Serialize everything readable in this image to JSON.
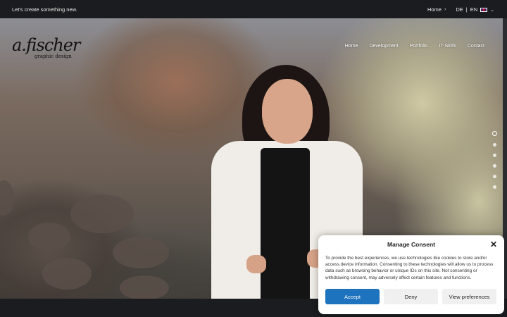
{
  "topbar": {
    "tagline": "Let's create something new.",
    "home_label": "Home",
    "lang_de": "DE",
    "lang_separator": "|",
    "lang_en": "EN"
  },
  "logo": {
    "signature": "a.fischer",
    "subtitle": "graphic design"
  },
  "nav": {
    "items": [
      {
        "label": "Home"
      },
      {
        "label": "Development"
      },
      {
        "label": "Portfolio"
      },
      {
        "label": "IT-Skills"
      },
      {
        "label": "Contact"
      }
    ]
  },
  "slider": {
    "dot_count": 6,
    "active_index": 0
  },
  "consent": {
    "title": "Manage Consent",
    "close_glyph": "✕",
    "message": "To provide the best experiences, we use technologies like cookies to store and/or access device information. Consenting to these technologies will allow us to process data such as browsing behavior or unique IDs on this site. Not consenting or withdrawing consent, may adversely affect certain features and functions.",
    "accept_label": "Accept",
    "deny_label": "Deny",
    "prefs_label": "View preferences"
  },
  "colors": {
    "accent": "#1e73be",
    "topbar_bg": "#1a1c1f"
  }
}
